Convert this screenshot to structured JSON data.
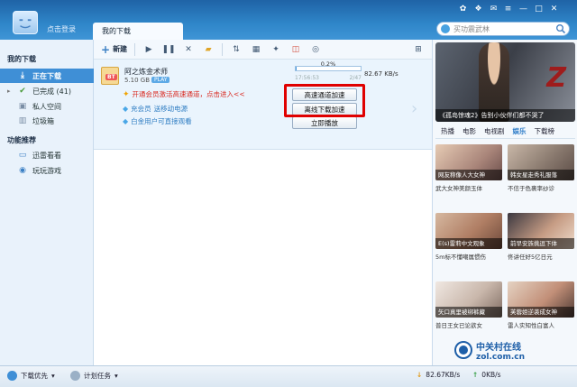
{
  "title_bar": {
    "login_text": "点击登录",
    "tab_label": "我的下载",
    "window_controls_left": [
      "✿",
      "❖",
      "✉"
    ],
    "window_controls_right": [
      "≡",
      "—",
      "□",
      "✕"
    ],
    "search_placeholder": "买功震武林"
  },
  "sidebar": {
    "section_downloads": "我的下载",
    "items": [
      {
        "label": "正在下载",
        "icon": "download-icon",
        "glyph": "⤓"
      },
      {
        "label": "已完成 (41)",
        "icon": "check-icon",
        "glyph": "✔"
      },
      {
        "label": "私人空间",
        "icon": "lock-icon",
        "glyph": "▣"
      },
      {
        "label": "垃圾箱",
        "icon": "trash-icon",
        "glyph": "▥"
      }
    ],
    "section_featured": "功能推荐",
    "featured": [
      {
        "label": "迅雷看看",
        "icon": "tv-icon",
        "glyph": "▭"
      },
      {
        "label": "玩玩游戏",
        "icon": "gamepad-icon",
        "glyph": "◉"
      }
    ]
  },
  "toolbar": {
    "new_label": "新建",
    "play_glyph": "▶",
    "pause_glyph": "❚❚",
    "delete_glyph": "✕",
    "folder_glyph": "▰",
    "sort_glyph": "⇅",
    "detail_glyph": "▦",
    "settings_glyph": "✦",
    "theme_glyph": "◫",
    "game_glyph": "◎",
    "grid_glyph": "⊞"
  },
  "task": {
    "name": "阿之炼金术师",
    "size": "5.10 GB",
    "bt_label": "BT",
    "play_label": "PLAY",
    "progress_pct": 0.2,
    "progress_label": "0.2%",
    "eta_left": "17:56:53",
    "eta_right": "2/47",
    "speed": "82.67 KB/s",
    "hint_vip": "开通会员激活高速通道，点击进入<<",
    "hint_points_a": "充会员",
    "hint_points_b": "送移动电源",
    "hint_platinum": "白金用户可直接观看",
    "btn_high_speed": "高速通道加速",
    "btn_offline": "离线下载加速",
    "btn_play_now": "立即播放"
  },
  "panel": {
    "hero_caption": "《孤岛惊魂2》告别小伙伴们都不哭了",
    "tabs": [
      "热播",
      "电影",
      "电视剧",
      "娱乐",
      "下载榜"
    ],
    "active_tab": 3,
    "cards": [
      {
        "caption": "网友称像人大女神",
        "sub": "武大女神美颜玉体"
      },
      {
        "caption": "韩女星走秀礼服落",
        "sub": "不信于色裹率纱诊"
      },
      {
        "caption": "E(s)雷莉中文观象",
        "sub": "5m标不懂嘲属惯伤"
      },
      {
        "caption": "前早安族挑逗下体",
        "sub": "佟讲任好5亿日元"
      },
      {
        "caption": "矢口真里被绑裤藏",
        "sub": "普日王女已论欲女"
      },
      {
        "caption": "芙蓉姐逆袭成女神",
        "sub": "雷人实知性白富人"
      }
    ]
  },
  "watermark": {
    "cn": "中关村在线",
    "en": "zol.com.cn"
  },
  "status_bar": {
    "priority": "下载优先",
    "schedule": "计划任务",
    "down_speed": "82.67KB/s",
    "up_speed": "0KB/s"
  }
}
